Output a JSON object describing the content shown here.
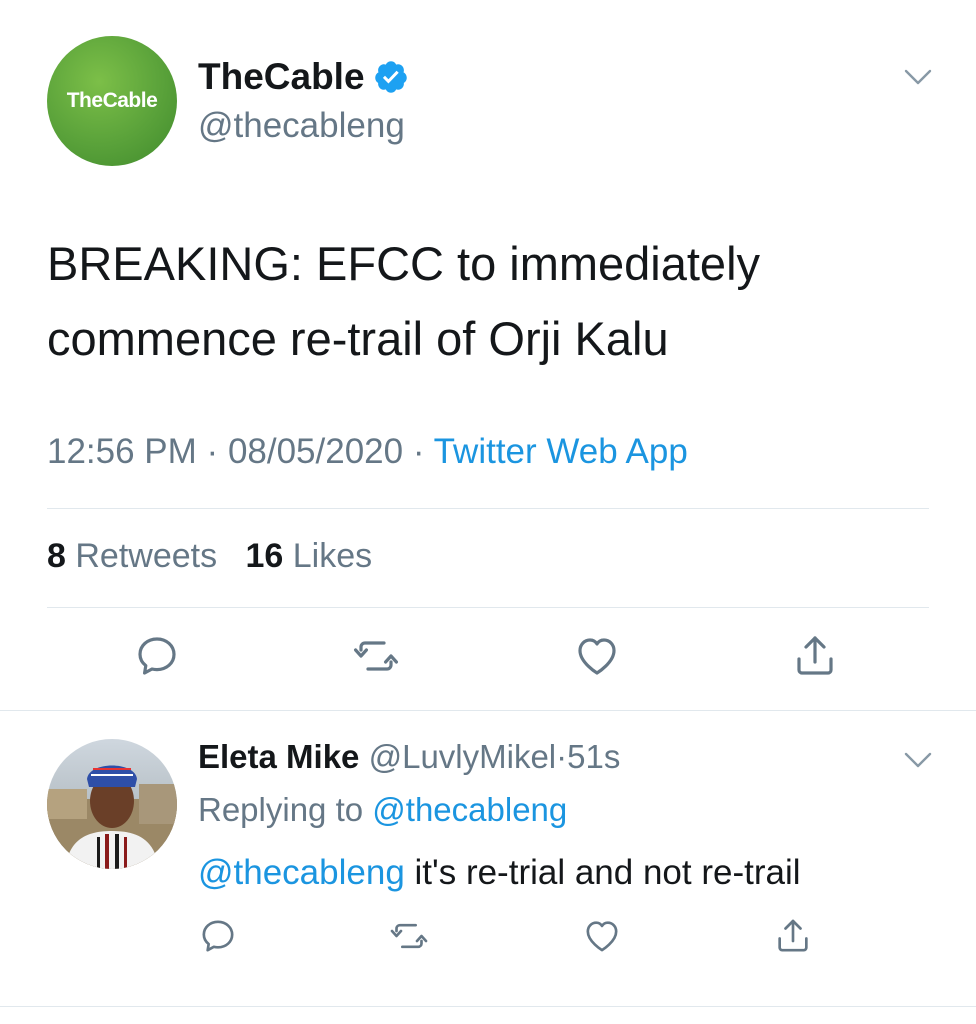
{
  "tweet": {
    "avatar_text": "TheCable",
    "author_name": "TheCable",
    "author_handle": "@thecableng",
    "text": "BREAKING: EFCC to immediately commence re-trail of Orji Kalu",
    "time": "12:56 PM",
    "date": "08/05/2020",
    "separator": "·",
    "source": "Twitter Web App",
    "retweets_count": "8",
    "retweets_label": "Retweets",
    "likes_count": "16",
    "likes_label": "Likes"
  },
  "reply": {
    "author_name": "Eleta Mike",
    "author_handle": "@LuvlyMikel",
    "time": "51s",
    "separator": "·",
    "replying_label": "Replying to",
    "replying_to": "@thecableng",
    "mention": "@thecableng",
    "text": "it's re-trial and not re-trail"
  },
  "icons": {
    "verified": "verified-badge-icon",
    "chevron": "chevron-down-icon",
    "reply": "reply-icon",
    "retweet": "retweet-icon",
    "like": "heart-icon",
    "share": "share-icon"
  },
  "colors": {
    "text_primary": "#14171a",
    "text_secondary": "#657786",
    "link": "#1b95e0",
    "divider": "#e1e8ed",
    "brand_green": "#5aa23a"
  }
}
